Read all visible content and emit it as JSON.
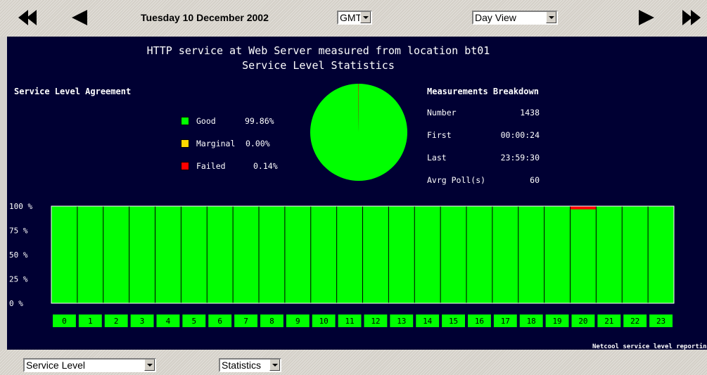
{
  "nav": {
    "date": "Tuesday 10 December 2002",
    "timezone": "GMT",
    "view": "Day View"
  },
  "report": {
    "title_line1": "HTTP service at Web Server measured from location bt01",
    "title_line2": "Service Level Statistics",
    "sla_heading": "Service Level Agreement",
    "legend": [
      {
        "label": "Good",
        "value": "99.86%",
        "color": "#00ff00"
      },
      {
        "label": "Marginal",
        "value": "0.00%",
        "color": "#ffd800"
      },
      {
        "label": "Failed",
        "value": "0.14%",
        "color": "#ff0000"
      }
    ],
    "measurements_heading": "Measurements Breakdown",
    "measurements": [
      {
        "label": "Number",
        "value": "1438"
      },
      {
        "label": "First",
        "value": "00:00:24"
      },
      {
        "label": "Last",
        "value": "23:59:30"
      },
      {
        "label": "Avrg Poll(s)",
        "value": "60"
      }
    ],
    "pie": [
      {
        "name": "Good",
        "percent": 99.86
      },
      {
        "name": "Marginal",
        "percent": 0.0
      },
      {
        "name": "Failed",
        "percent": 0.14
      }
    ],
    "footer_credit": "Netcool service level reporting"
  },
  "chart_data": {
    "type": "bar",
    "categories": [
      "0",
      "1",
      "2",
      "3",
      "4",
      "5",
      "6",
      "7",
      "8",
      "9",
      "10",
      "11",
      "12",
      "13",
      "14",
      "15",
      "16",
      "17",
      "18",
      "19",
      "20",
      "21",
      "22",
      "23"
    ],
    "ytick_labels": [
      "100 %",
      "75 %",
      "50 %",
      "25 %",
      "0 %"
    ],
    "ylim": [
      0,
      100
    ],
    "series": [
      {
        "name": "Good",
        "color": "#00ff00",
        "values": [
          100,
          100,
          100,
          100,
          100,
          100,
          100,
          100,
          100,
          100,
          100,
          100,
          100,
          100,
          100,
          100,
          100,
          100,
          100,
          100,
          96.7,
          100,
          100,
          100
        ]
      },
      {
        "name": "Failed",
        "color": "#ff0000",
        "values": [
          0,
          0,
          0,
          0,
          0,
          0,
          0,
          0,
          0,
          0,
          0,
          0,
          0,
          0,
          0,
          0,
          0,
          0,
          0,
          0,
          3.3,
          0,
          0,
          0
        ]
      }
    ]
  },
  "bottom": {
    "report_type": "Service Level",
    "display_type": "Statistics"
  }
}
